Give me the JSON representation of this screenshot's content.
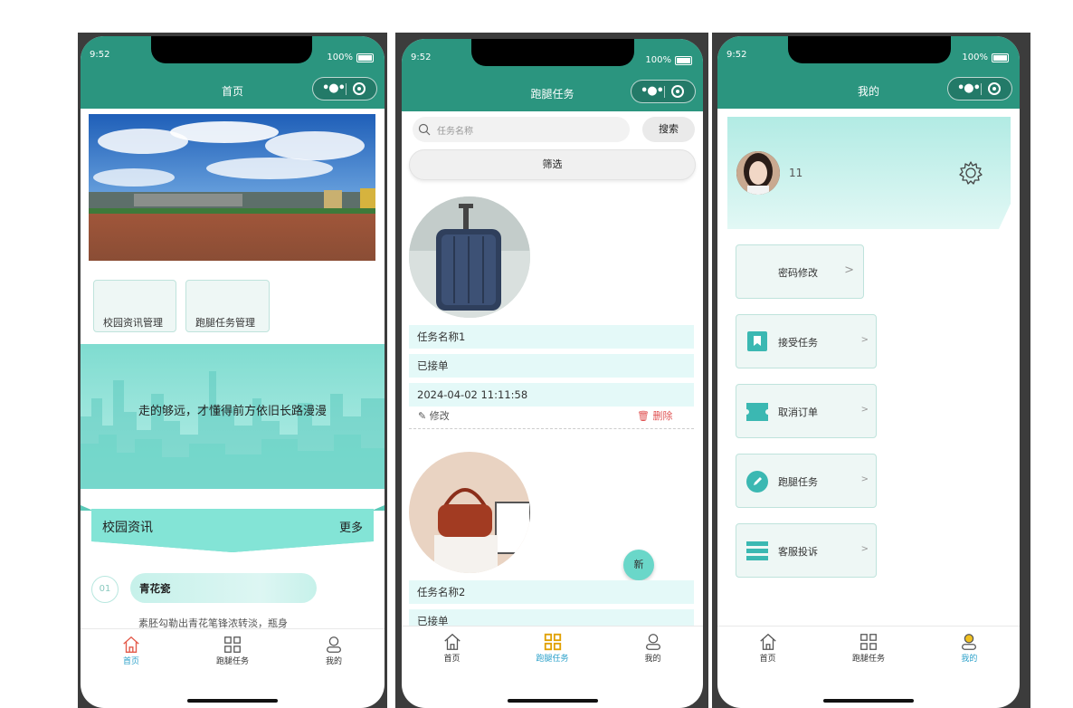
{
  "status": {
    "time": "9:52",
    "battery": "100%"
  },
  "phone1": {
    "title": "首页",
    "menu": [
      "校园资讯管理",
      "跑腿任务管理"
    ],
    "slogan": "走的够远，才懂得前方依旧长路漫漫",
    "news_header": {
      "title": "校园资讯",
      "more": "更多"
    },
    "news_item": {
      "index": "01",
      "title": "青花瓷",
      "excerpt": "素胚勾勒出青花笔锋浓转淡，瓶身"
    }
  },
  "phone2": {
    "title": "跑腿任务",
    "search": {
      "placeholder": "任务名称",
      "button": "搜索"
    },
    "filter_label": "筛选",
    "tasks": [
      {
        "name": "任务名称1",
        "status": "已接单",
        "time": "2024-04-02 11:11:58",
        "edit": "修改",
        "delete": "删除"
      },
      {
        "name": "任务名称2",
        "status": "已接单"
      }
    ],
    "fab": "新"
  },
  "phone3": {
    "title": "我的",
    "username": "11",
    "menu": [
      {
        "label": "密码修改",
        "icon": "none"
      },
      {
        "label": "接受任务",
        "icon": "bookmark-icon"
      },
      {
        "label": "取消订单",
        "icon": "ticket-icon"
      },
      {
        "label": "跑腿任务",
        "icon": "pencil-circle-icon"
      },
      {
        "label": "客服投诉",
        "icon": "list-icon"
      }
    ]
  },
  "tabs": [
    "首页",
    "跑腿任务",
    "我的"
  ],
  "colors": {
    "primary": "#2b957f",
    "accent_mint": "#83e4d6",
    "tab_active": "#2aa0c9",
    "delete": "#e05353"
  }
}
